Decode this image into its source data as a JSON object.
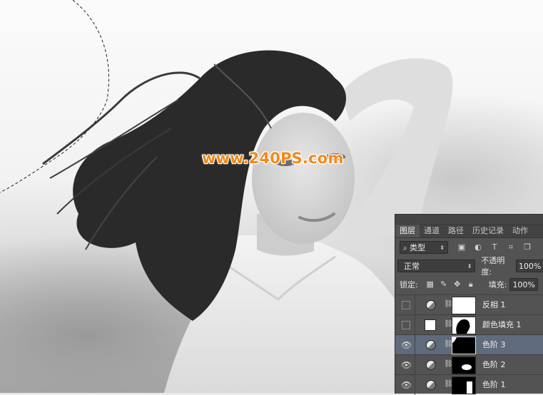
{
  "watermark": "www.240PS.com",
  "panel": {
    "tabs": [
      "图层",
      "通道",
      "路径",
      "历史记录",
      "动作"
    ],
    "active_tab": "图层",
    "filter": {
      "kind_label": "类型",
      "search_icon": "search-icon"
    },
    "filter_icons": [
      "image-filter-icon",
      "adjustment-filter-icon",
      "type-filter-icon",
      "shape-filter-icon",
      "smart-object-filter-icon"
    ],
    "blend_mode": "正常",
    "opacity_label": "不透明度:",
    "opacity_value": "100%",
    "lock_label": "锁定:",
    "lock_icons": [
      "lock-transparent-icon",
      "lock-paint-icon",
      "lock-position-icon",
      "lock-all-icon"
    ],
    "fill_label": "填充:",
    "fill_value": "100%",
    "layers": [
      {
        "name": "反相 1",
        "visible": false,
        "kind": "adjustment",
        "active": false
      },
      {
        "name": "颜色填充 1",
        "visible": false,
        "kind": "solid-fill",
        "active": false
      },
      {
        "name": "色阶 3",
        "visible": true,
        "kind": "adjustment",
        "active": true
      },
      {
        "name": "色阶 2",
        "visible": true,
        "kind": "adjustment",
        "active": false
      },
      {
        "name": "色阶 1",
        "visible": true,
        "kind": "adjustment",
        "active": false
      }
    ]
  },
  "colors": {
    "panel_bg": "#535353",
    "selected_row": "#5f6a7c",
    "watermark": "#f08a1a"
  }
}
